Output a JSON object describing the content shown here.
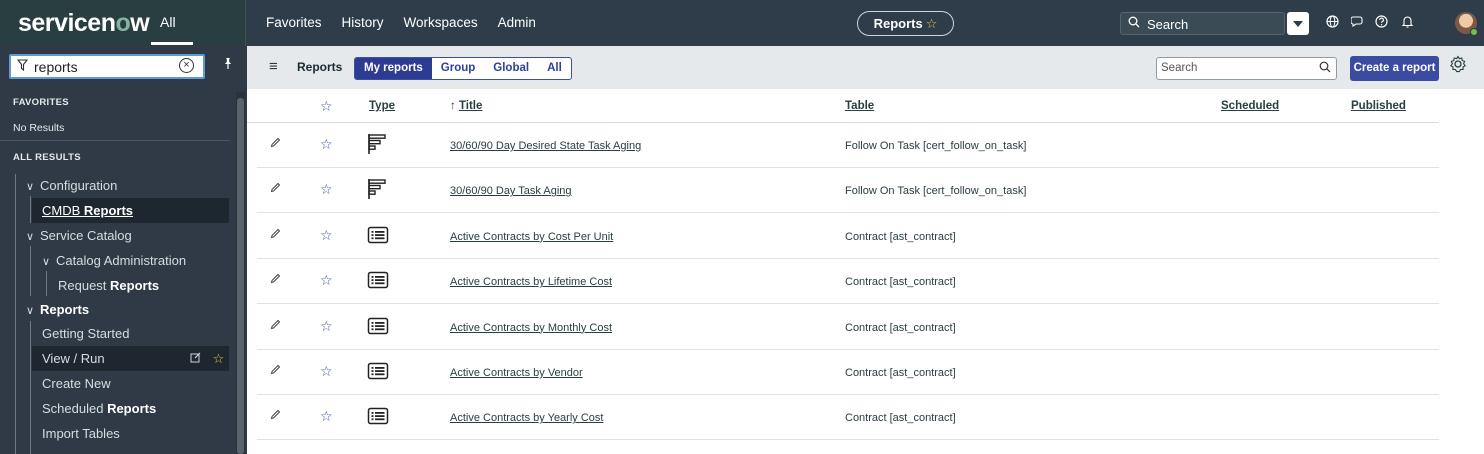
{
  "header": {
    "logo": {
      "prefix": "servicen",
      "o": "o",
      "suffix": "w"
    },
    "all_tab": "All",
    "menus": [
      "Favorites",
      "History",
      "Workspaces",
      "Admin"
    ],
    "context_pill": "Reports",
    "search_label": "Search",
    "icons": [
      "globe-icon",
      "chat-icon",
      "help-icon",
      "bell-icon"
    ]
  },
  "sidebar": {
    "filter_value": "reports",
    "favorites_header": "FAVORITES",
    "favorites_empty": "No Results",
    "all_results_header": "ALL RESULTS",
    "items": [
      {
        "label": "Configuration"
      },
      {
        "pre": "CMDB ",
        "bold": "Reports"
      },
      {
        "label": "Service Catalog"
      },
      {
        "label": "Catalog Administration"
      },
      {
        "pre": "Request ",
        "bold": "Reports"
      },
      {
        "bold": "Reports"
      },
      {
        "label": "Getting Started"
      },
      {
        "label": "View / Run"
      },
      {
        "label": "Create New"
      },
      {
        "pre": "Scheduled ",
        "bold": "Reports"
      },
      {
        "label": "Import Tables"
      }
    ]
  },
  "toolbar": {
    "title": "Reports",
    "tabs": [
      "My reports",
      "Group",
      "Global",
      "All"
    ],
    "active_tab": "My reports",
    "search_placeholder": "Search",
    "create_label": "Create a report"
  },
  "table": {
    "columns": {
      "type": "Type",
      "title": "Title",
      "title_sort": "↑",
      "table": "Table",
      "scheduled": "Scheduled",
      "published": "Published"
    },
    "rows": [
      {
        "type": "bar-chart",
        "title": "30/60/90 Day Desired State Task Aging",
        "table": "Follow On Task [cert_follow_on_task]"
      },
      {
        "type": "bar-chart",
        "title": "30/60/90 Day Task Aging",
        "table": "Follow On Task [cert_follow_on_task]"
      },
      {
        "type": "list",
        "title": "Active Contracts by Cost Per Unit",
        "table": "Contract [ast_contract]"
      },
      {
        "type": "list",
        "title": "Active Contracts by Lifetime Cost",
        "table": "Contract [ast_contract]"
      },
      {
        "type": "list",
        "title": "Active Contracts by Monthly Cost",
        "table": "Contract [ast_contract]"
      },
      {
        "type": "list",
        "title": "Active Contracts by Vendor",
        "table": "Contract [ast_contract]"
      },
      {
        "type": "list",
        "title": "Active Contracts by Yearly Cost",
        "table": "Contract [ast_contract]"
      }
    ]
  },
  "colors": {
    "header_bg": "#2e3d49",
    "sidebar_bg": "#303a46",
    "accent": "#3a4ba0",
    "toolbar_bg": "#e5e9ec"
  }
}
